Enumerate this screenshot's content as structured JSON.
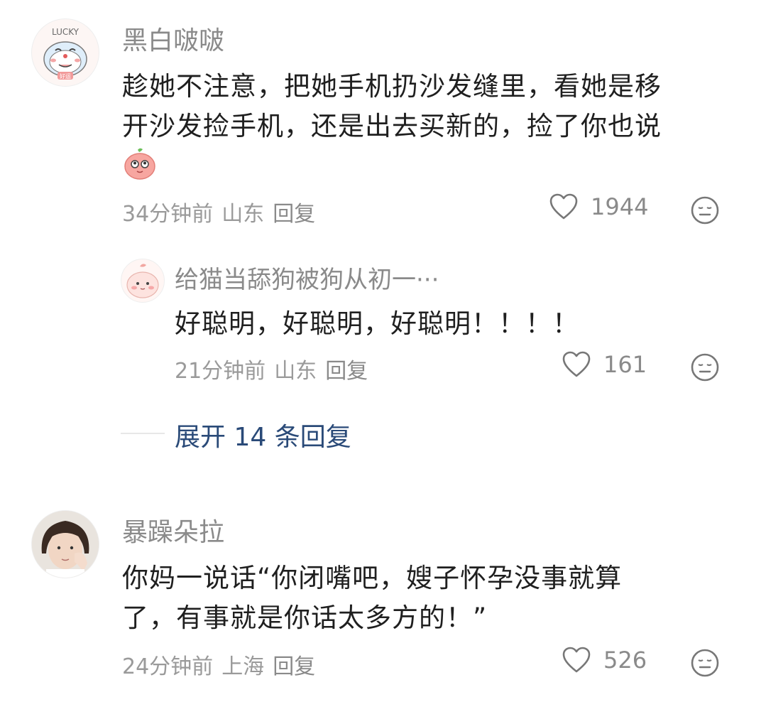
{
  "comments": [
    {
      "username": "黑白啵啵",
      "avatar_text": "LUCKY",
      "avatar_badge": "好运",
      "text_line1": "趁她不注意，把她手机扔沙发缝里，看她是移",
      "text_line2": "开沙发捡手机，还是出去买新的，捡了你也说",
      "emoji": "smiling-peach-emoji",
      "time": "34分钟前",
      "location": "山东",
      "reply_label": "回复",
      "likes": "1944",
      "replies": [
        {
          "username": "给猫当舔狗被狗从初一···",
          "text": "好聪明，好聪明，好聪明！！！！",
          "time": "21分钟前",
          "location": "山东",
          "reply_label": "回复",
          "likes": "161"
        }
      ],
      "expand_label": "展开 14 条回复"
    },
    {
      "username": "暴躁朵拉",
      "text_line1": "你妈一说话“你闭嘴吧，嫂子怀孕没事就算",
      "text_line2": "了，有事就是你话太多方的！”",
      "time": "24分钟前",
      "location": "上海",
      "reply_label": "回复",
      "likes": "526"
    }
  ],
  "colors": {
    "username": "#8a8a8a",
    "meta": "#9a9a9a",
    "expand": "#2a4a78",
    "text": "#1f1f1f"
  },
  "icons": [
    "heart-outline-icon",
    "neutral-face-icon"
  ]
}
